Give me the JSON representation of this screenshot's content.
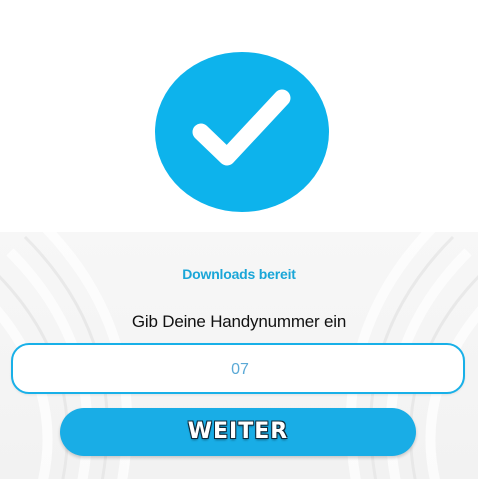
{
  "status": {
    "title": "Downloads bereit",
    "icon": "checkmark-icon"
  },
  "form": {
    "prompt": "Gib Deine Handynummer ein",
    "phone_value": "07",
    "submit_label": "WEITER"
  },
  "colors": {
    "accent": "#0db3ec",
    "title": "#1aa6d8",
    "button": "#19ade6"
  }
}
